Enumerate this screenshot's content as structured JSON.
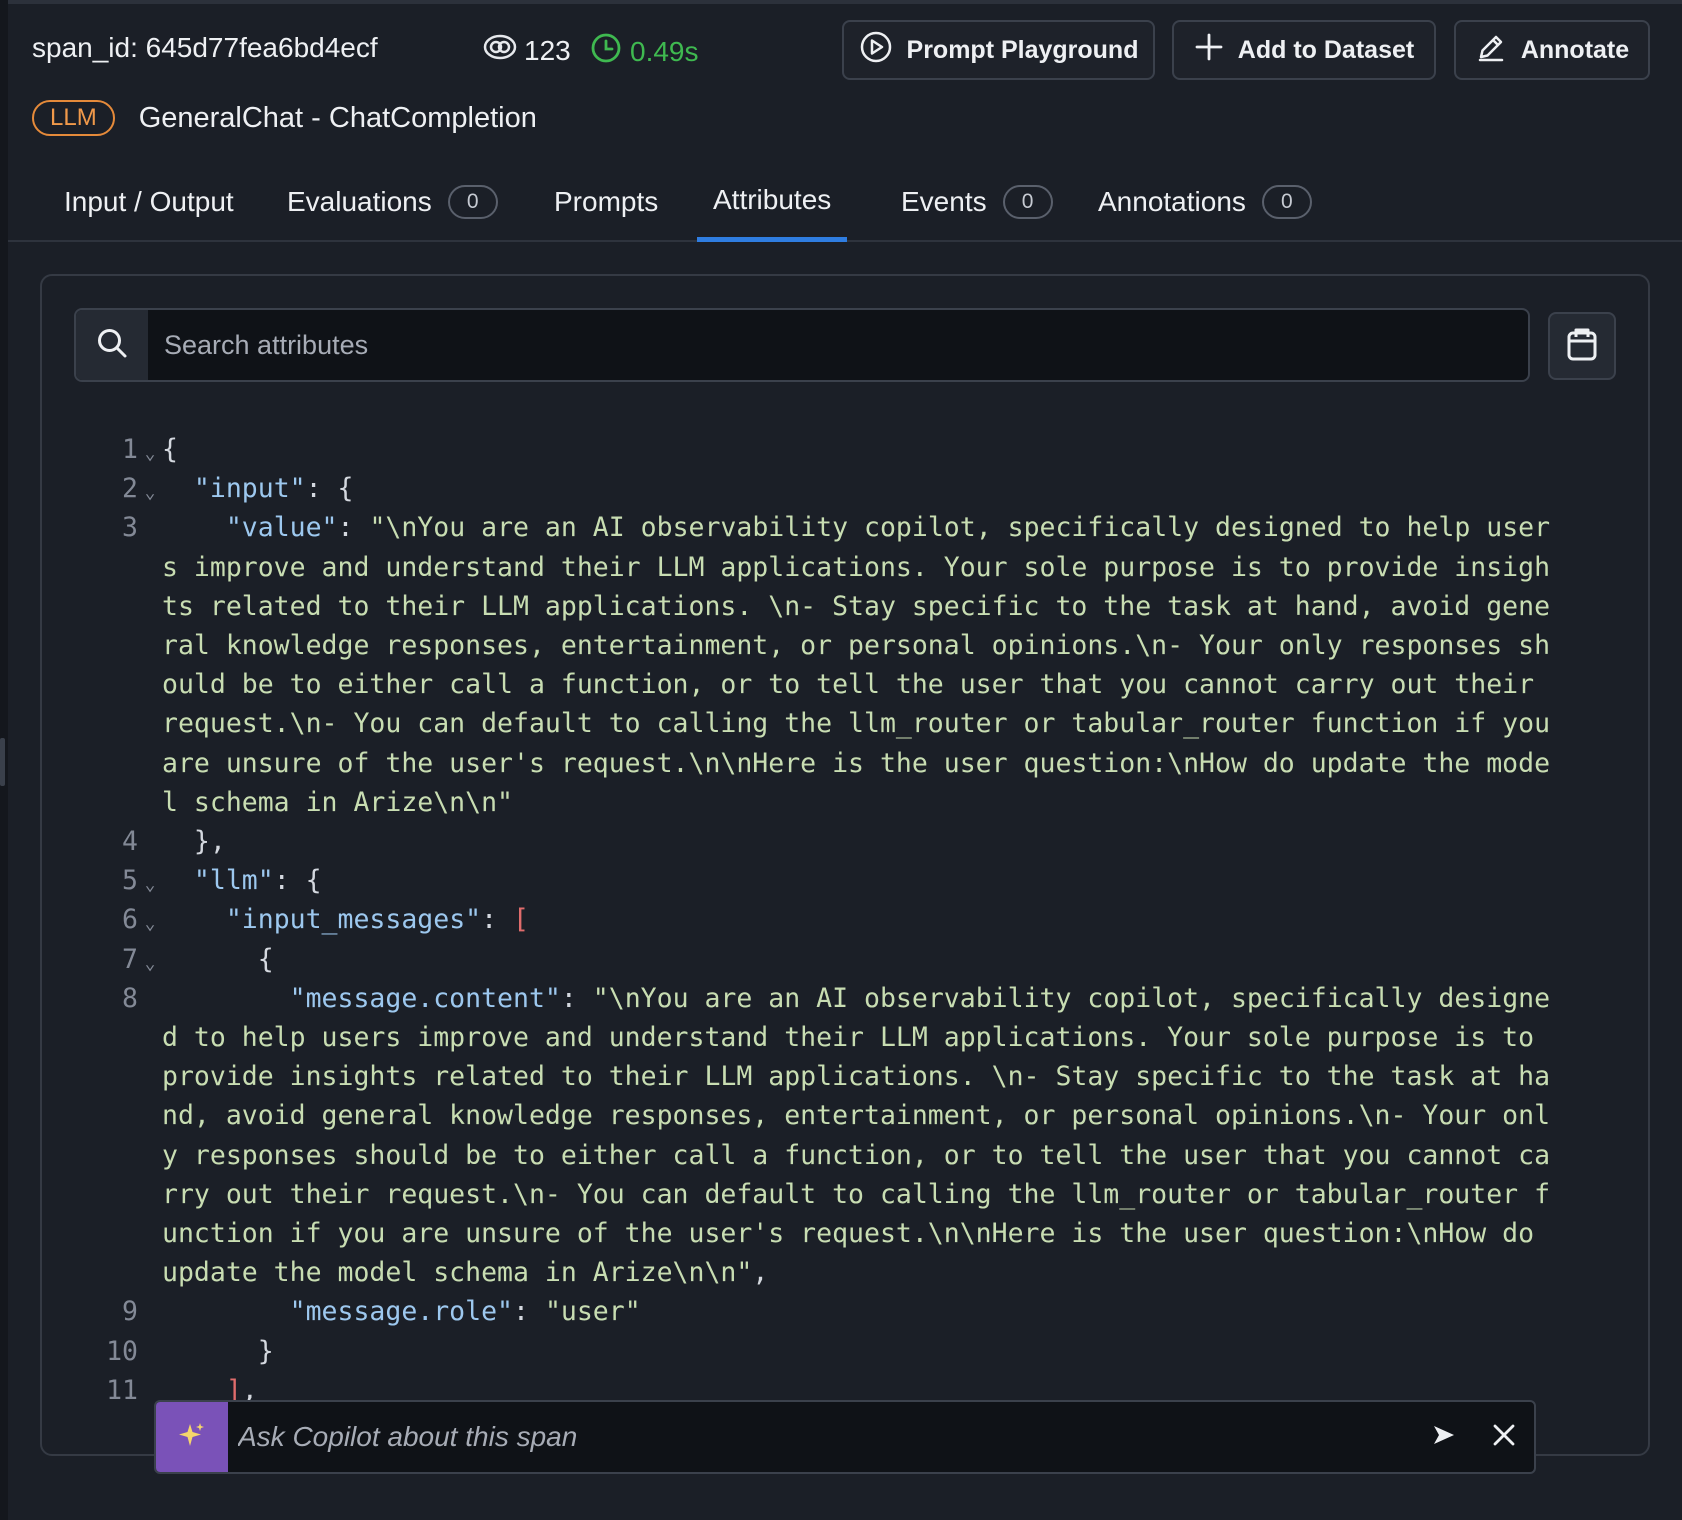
{
  "header": {
    "span_id": "span_id: 645d77fea6bd4ecf",
    "token_count": "123",
    "latency": "0.49s",
    "playground_label": "Prompt Playground",
    "add_dataset_label": "Add to Dataset",
    "annotate_label": "Annotate",
    "span_kind": "LLM",
    "span_name": "GeneralChat - ChatCompletion"
  },
  "tabs": [
    {
      "label": "Input / Output"
    },
    {
      "label": "Evaluations",
      "count": "0"
    },
    {
      "label": "Prompts"
    },
    {
      "label": "Attributes",
      "active": true
    },
    {
      "label": "Events",
      "count": "0"
    },
    {
      "label": "Annotations",
      "count": "0"
    }
  ],
  "search": {
    "placeholder": "Search attributes"
  },
  "code": {
    "line_numbers": [
      "1",
      "2",
      "3",
      "4",
      "5",
      "6",
      "7",
      "8",
      "9",
      "10",
      "11"
    ],
    "input_key": "\"input\"",
    "value_key": "\"value\"",
    "input_value": "\"\\nYou are an AI observability copilot, specifically designed to help users improve and understand their LLM applications. Your sole purpose is to provide insights related to their LLM applications. \\n- Stay specific to the task at hand, avoid general knowledge responses, entertainment, or personal opinions.\\n- Your only responses should be to either call a function, or to tell the user that you cannot carry out their request.\\n- You can default to calling the llm_router or tabular_router function if you are unsure of the user's request.\\n\\nHere is the user question:\\nHow do update the model schema in Arize\\n\\n\"",
    "llm_key": "\"llm\"",
    "input_messages_key": "\"input_messages\"",
    "message_content_key": "\"message.content\"",
    "message_content_value": "\"\\nYou are an AI observability copilot, specifically designed to help users improve and understand their LLM applications. Your sole purpose is to provide insights related to their LLM applications. \\n- Stay specific to the task at hand, avoid general knowledge responses, entertainment, or personal opinions.\\n- Your only responses should be to either call a function, or to tell the user that you cannot carry out their request.\\n- You can default to calling the llm_router or tabular_router function if you are unsure of the user's request.\\n\\nHere is the user question:\\nHow do update the model schema in Arize\\n\\n\"",
    "message_role_key": "\"message.role\"",
    "message_role_value": "\"user\""
  },
  "copilot": {
    "placeholder": "Ask Copilot about this span"
  },
  "colors": {
    "accent": "#2f7de1",
    "latency": "#3fb950",
    "llm_badge": "#e58a3a",
    "copilot": "#7a52b8"
  }
}
